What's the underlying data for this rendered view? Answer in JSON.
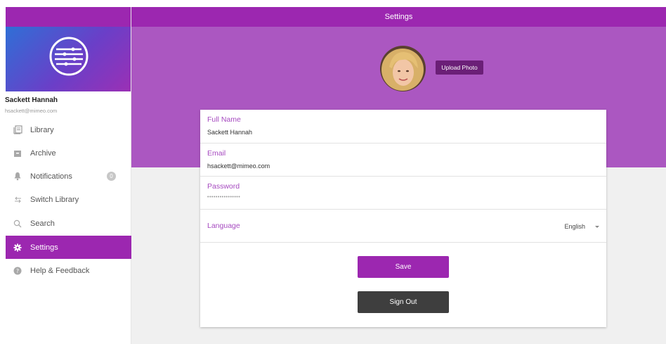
{
  "header": {
    "title": "Settings"
  },
  "user": {
    "name": "Sackett Hannah",
    "email": "hsackett@mimeo.com"
  },
  "sidebar": {
    "items": [
      {
        "label": "Library",
        "icon": "library-icon"
      },
      {
        "label": "Archive",
        "icon": "archive-icon"
      },
      {
        "label": "Notifications",
        "icon": "bell-icon",
        "badge": "0"
      },
      {
        "label": "Switch Library",
        "icon": "switch-icon"
      },
      {
        "label": "Search",
        "icon": "search-icon"
      },
      {
        "label": "Settings",
        "icon": "gear-icon",
        "active": true
      },
      {
        "label": "Help & Feedback",
        "icon": "help-icon"
      }
    ]
  },
  "profile": {
    "upload_label": "Upload Photo"
  },
  "form": {
    "full_name": {
      "label": "Full Name",
      "value": "Sackett Hannah"
    },
    "email": {
      "label": "Email",
      "value": "hsackett@mimeo.com"
    },
    "password": {
      "label": "Password",
      "value": "••••••••••••••••"
    },
    "language": {
      "label": "Language",
      "value": "English"
    }
  },
  "actions": {
    "save_label": "Save",
    "signout_label": "Sign Out"
  },
  "colors": {
    "accent": "#9c27b0",
    "hero": "#ab57c1",
    "upload_button": "#6b1f77",
    "signout_button": "#3e3e3e"
  }
}
